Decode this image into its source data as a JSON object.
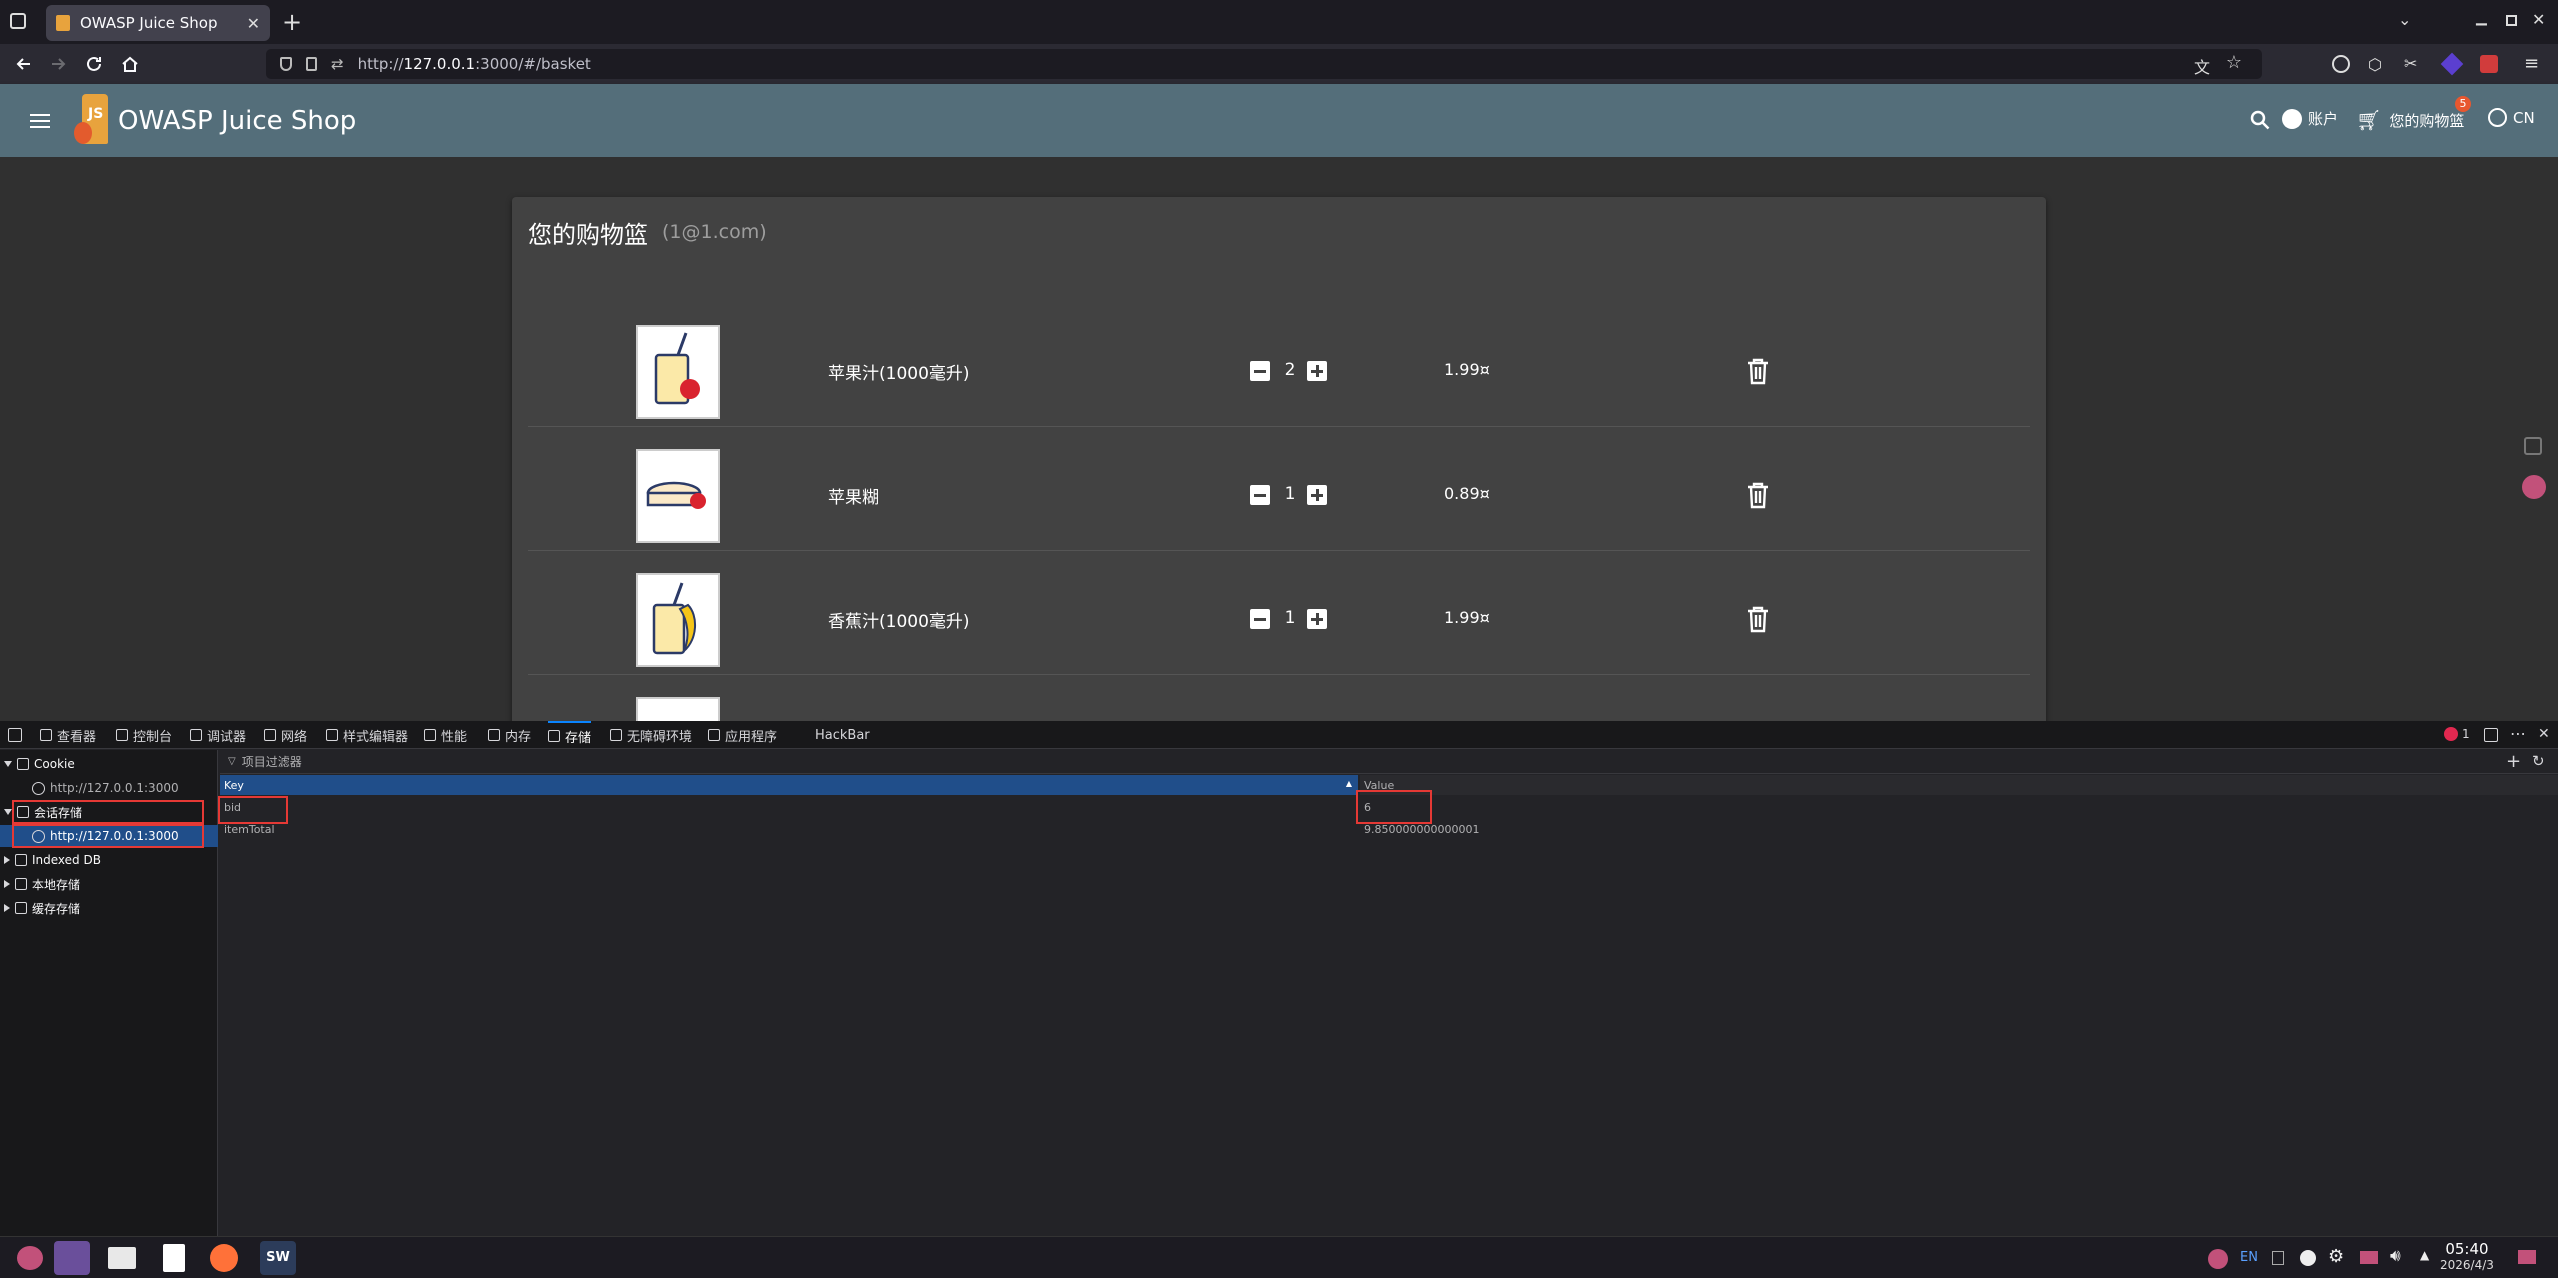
{
  "browser": {
    "tab_title": "OWASP Juice Shop",
    "url_prefix": "http://",
    "url_host": "127.0.0.1",
    "url_rest": ":3000/#/basket"
  },
  "app": {
    "title": "OWASP Juice Shop",
    "account_label": "账户",
    "basket_label": "您的购物篮",
    "basket_badge": "5",
    "language": "CN"
  },
  "basket": {
    "title": "您的购物篮",
    "user": "(1@1.com)",
    "items": [
      {
        "name": "苹果汁(1000毫升)",
        "quantity": "2",
        "price": "1.99¤"
      },
      {
        "name": "苹果糊",
        "quantity": "1",
        "price": "0.89¤"
      },
      {
        "name": "香蕉汁(1000毫升)",
        "quantity": "1",
        "price": "1.99¤"
      }
    ]
  },
  "devtools": {
    "tabs": [
      "查看器",
      "控制台",
      "调试器",
      "网络",
      "样式编辑器",
      "性能",
      "内存",
      "存储",
      "无障碍环境",
      "应用程序",
      "HackBar"
    ],
    "error_count": "1",
    "tree": {
      "cookie": "Cookie",
      "cookie_host": "http://127.0.0.1:3000",
      "session": "会话存储",
      "session_host": "http://127.0.0.1:3000",
      "indexed_db": "Indexed DB",
      "local": "本地存储",
      "cache": "缓存存储"
    },
    "filter_placeholder": "项目过滤器",
    "columns": {
      "key": "Key",
      "value": "Value"
    },
    "rows": [
      {
        "key": "bid",
        "value": "6"
      },
      {
        "key": "itemTotal",
        "value": "9.850000000000001"
      }
    ]
  },
  "taskbar": {
    "ime": "EN",
    "time": "05:40",
    "date": "2026/4/3"
  },
  "colors": {
    "toolbar": "#546e7a",
    "content_bg": "#303030",
    "card_bg": "#424242",
    "selection": "#204e8a",
    "annotation": "#e53935"
  }
}
